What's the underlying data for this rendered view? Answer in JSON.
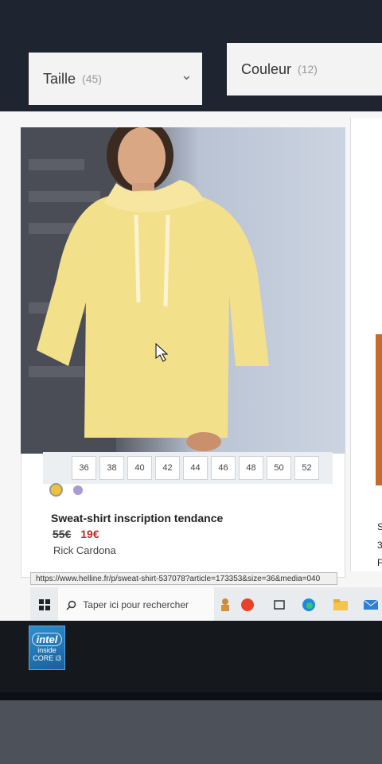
{
  "filters": {
    "size": {
      "label": "Taille",
      "count": "(45)"
    },
    "color": {
      "label": "Couleur",
      "count": "(12)"
    }
  },
  "product": {
    "title": "Sweat-shirt inscription tendance",
    "old_price": "55€",
    "new_price": "19€",
    "brand": "Rick Cardona",
    "sizes": [
      "36",
      "38",
      "40",
      "42",
      "44",
      "46",
      "48",
      "50",
      "52"
    ],
    "swatch_colors": [
      "#f0c23a",
      "#a99ad4"
    ]
  },
  "neighbor_card_text": [
    "S",
    "3",
    "F"
  ],
  "status_url": "https://www.helline.fr/p/sweat-shirt-537078?article=173353&size=36&media=040",
  "taskbar": {
    "search_placeholder": "Taper ici pour rechercher",
    "apps": [
      "cortana-app",
      "record-app",
      "task-view",
      "edge-browser",
      "file-explorer",
      "mail-app"
    ]
  },
  "sticker": {
    "brand": "intel",
    "line1": "inside",
    "line2": "CORE i3"
  }
}
